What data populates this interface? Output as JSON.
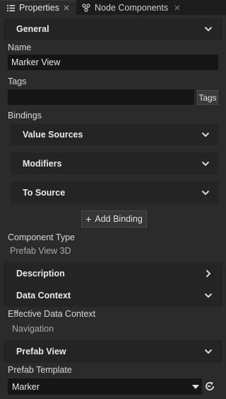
{
  "tabs": [
    {
      "label": "Properties",
      "icon": "list-icon",
      "active": true
    },
    {
      "label": "Node Components",
      "icon": "components-icon",
      "active": false
    }
  ],
  "general": {
    "title": "General",
    "icon": "chevron-down-icon"
  },
  "name": {
    "label": "Name",
    "value": "Marker View"
  },
  "tags": {
    "label": "Tags",
    "value": "",
    "button_label": "Tags"
  },
  "bindings": {
    "label": "Bindings",
    "groups": [
      {
        "title": "Value Sources",
        "icon": "chevron-down-icon"
      },
      {
        "title": "Modifiers",
        "icon": "chevron-down-icon"
      },
      {
        "title": "To Source",
        "icon": "chevron-down-icon"
      }
    ],
    "add_button": "Add Binding"
  },
  "component_type": {
    "label": "Component Type",
    "value": "Prefab View 3D"
  },
  "description": {
    "title": "Description",
    "icon": "chevron-right-icon"
  },
  "data_context": {
    "title": "Data Context",
    "icon": "chevron-down-icon"
  },
  "effective_data_context": {
    "label": "Effective Data Context",
    "value": "Navigation"
  },
  "prefab_view": {
    "title": "Prefab View",
    "icon": "chevron-down-icon"
  },
  "prefab_template": {
    "label": "Prefab Template",
    "value": "Marker",
    "icon": "refresh-icon"
  },
  "colors": {
    "background": "#2b2b2b",
    "section": "#242424",
    "field": "#161616",
    "text": "#d4d4d4"
  }
}
